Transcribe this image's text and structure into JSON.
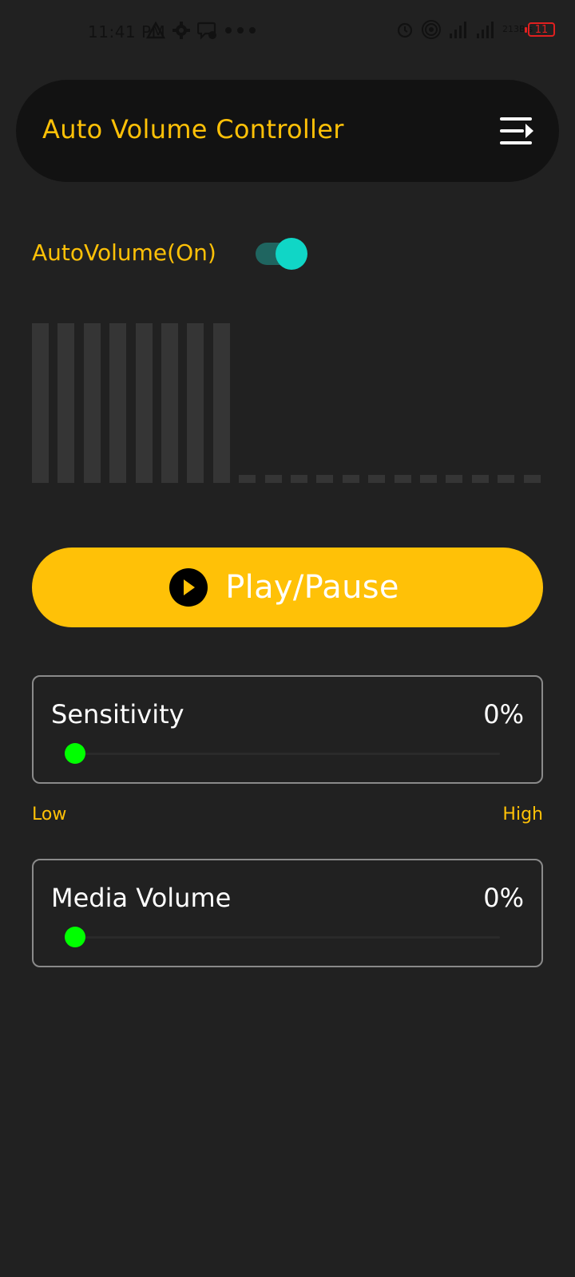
{
  "status_bar": {
    "time": "11:41 PM",
    "net_speed_value": "213",
    "net_speed_unit": "B/s",
    "network_type": "4G",
    "battery_level": "11",
    "battery_color": "#e02020",
    "icons": [
      "warning-triangle-icon",
      "gear-icon",
      "message-bubble-icon",
      "more-dots-icon",
      "alarm-icon",
      "hotspot-icon",
      "signal-4g-icon",
      "signal-icon",
      "battery-icon"
    ]
  },
  "header": {
    "title": "Auto Volume Controller",
    "menu_icon": "menu-icon"
  },
  "auto_volume": {
    "label": "AutoVolume(On)",
    "enabled": true
  },
  "level_meter": {
    "active_bars": 8,
    "total_bars": 20
  },
  "player": {
    "button_label": "Play/Pause",
    "icon": "play-icon"
  },
  "sensitivity": {
    "title": "Sensitivity",
    "value": "0%",
    "level": 0,
    "low_label": "Low",
    "high_label": "High"
  },
  "media_volume": {
    "title": "Media Volume",
    "value": "0%",
    "level": 0
  },
  "colors": {
    "background": "#212121",
    "header_bg": "#121212",
    "accent": "#ffc107",
    "toggle_thumb": "#10d6c6",
    "toggle_track": "#1f6560",
    "slider_thumb": "#00ff00",
    "card_border": "#8a8a8a",
    "level_bar": "#353535"
  }
}
